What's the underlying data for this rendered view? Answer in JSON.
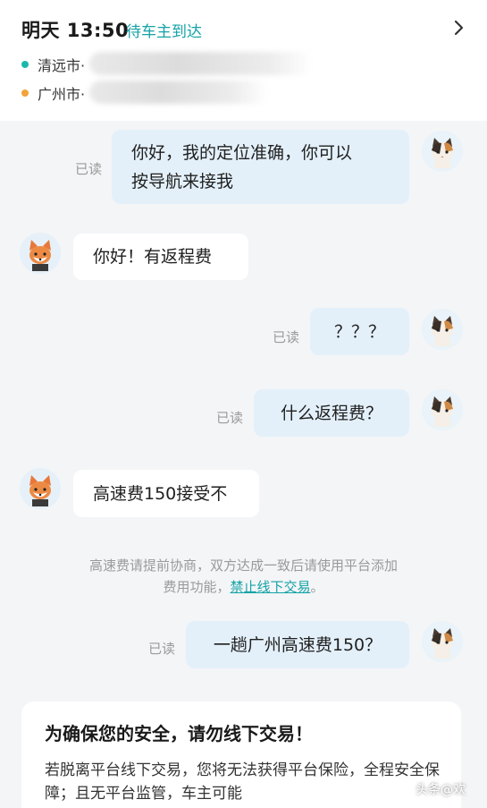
{
  "header": {
    "time": "明天 13:50",
    "status": "待车主到达",
    "start_city": "清远市·",
    "end_city": "广州市·"
  },
  "messages": [
    {
      "side": "me",
      "text_line1": "你好，我的定位准确，你可以",
      "text_line2": "按导航来接我",
      "read": "已读"
    },
    {
      "side": "peer",
      "text": "你好！有返程费"
    },
    {
      "side": "me",
      "text": "？？？",
      "read": "已读"
    },
    {
      "side": "me",
      "text": "什么返程费？",
      "read": "已读"
    },
    {
      "side": "peer",
      "text": "高速费150接受不"
    },
    {
      "side": "me",
      "text": "一趟广州高速费150？",
      "read": "已读"
    }
  ],
  "notice": {
    "line1": "高速费请提前协商，双方达成一致后请使用平台添加",
    "line2_prefix": "费用功能，",
    "link": "禁止线下交易",
    "line2_suffix": "。"
  },
  "warning_card": {
    "title": "为确保您的安全，请勿线下交易！",
    "body": "若脱离平台线下交易，您将无法获得平台保险，全程安全保障；且无平台监管，车主可能"
  },
  "watermark": "头条@欢",
  "colors": {
    "accent": "#14a3a8",
    "my_bubble": "#e3f0fa",
    "peer_bubble": "#ffffff",
    "background": "#f4f5f7"
  }
}
